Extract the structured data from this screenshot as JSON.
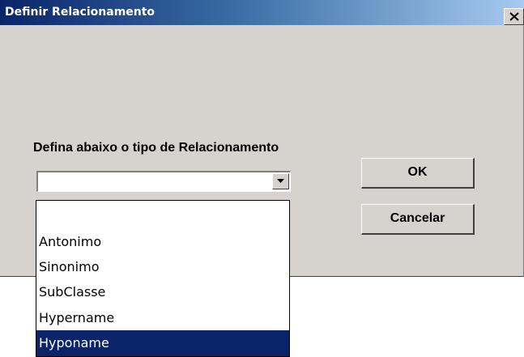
{
  "window": {
    "title": "Definir Relacionamento",
    "close_glyph": "close-icon"
  },
  "form": {
    "prompt_label": "Defina abaixo o tipo de Relacionamento",
    "combo_value": "",
    "combo_arrow_icon": "chevron-down-icon"
  },
  "buttons": {
    "ok_label": "OK",
    "cancel_label": "Cancelar"
  },
  "dropdown": {
    "options": [
      {
        "label": ""
      },
      {
        "label": "Antonimo"
      },
      {
        "label": "Sinonimo"
      },
      {
        "label": "SubClasse"
      },
      {
        "label": "Hypername"
      },
      {
        "label": "Hyponame"
      }
    ],
    "selected_index": 5
  },
  "colors": {
    "dialog_bg": "#d6d3ce",
    "titlebar_start": "#0a246a",
    "titlebar_end": "#a6caf0",
    "selection_bg": "#0a246a",
    "selection_fg": "#ffffff"
  }
}
